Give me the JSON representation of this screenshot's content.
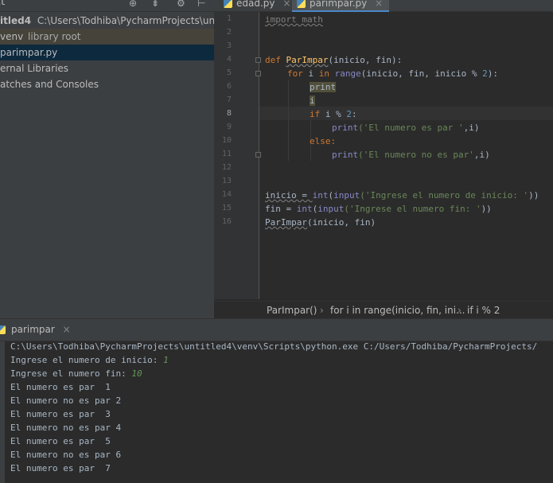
{
  "project": {
    "header_text": "ct",
    "rows": [
      {
        "name_bold": "itled4",
        "path": "C:\\Users\\Todhiba\\PycharmProjects\\untitled4"
      },
      {
        "name": "venv",
        "dim": "library root"
      },
      {
        "name": "parimpar.py",
        "selected": true
      },
      {
        "name": "ernal Libraries"
      },
      {
        "name": "atches and Consoles"
      }
    ]
  },
  "editor": {
    "tabs": [
      {
        "label": "edad.py",
        "active": false
      },
      {
        "label": "parimpar.py",
        "active": true
      }
    ],
    "current_line": 8,
    "line_numbers": [
      "1",
      "2",
      "3",
      "4",
      "5",
      "6",
      "7",
      "8",
      "9",
      "10",
      "11",
      "12",
      "13",
      "14",
      "15",
      "16"
    ],
    "code": {
      "l1": "import math",
      "l4_def": "def ",
      "l4_name": "ParImpar",
      "l4_rest": "(inicio, fin):",
      "l5_for": "for ",
      "l5_i": "i ",
      "l5_in": "in ",
      "l5_range": "range",
      "l5_rest": "(inicio, fin, inicio % ",
      "l5_num": "2",
      "l5_end": "):",
      "l6": "print",
      "l7": "i",
      "l8_if": "if ",
      "l8_rest": "i % ",
      "l8_num": "2",
      "l8_end": ":",
      "l9_print": "print",
      "l9_str": "('El numero es par '",
      "l9_end": ",i)",
      "l10": "else:",
      "l11_print": "print",
      "l11_str": "('El numero no es par'",
      "l11_end": ",i)",
      "l14_a": "inicio = ",
      "l14_int": "int",
      "l14_b": "(",
      "l14_input": "input",
      "l14_str": "('Ingrese el numero de inicio: '",
      "l14_end": "))",
      "l15_a": "fin = ",
      "l15_int": "int",
      "l15_b": "(",
      "l15_input": "input",
      "l15_str": "('Ingrese el numero fin: '",
      "l15_end": "))",
      "l16_name": "ParImpar",
      "l16_rest": "(inicio, fin)"
    },
    "breadcrumbs": [
      "ParImpar()",
      "for i in range(inicio, fin, ini...",
      "if i % 2"
    ]
  },
  "run": {
    "tab_label": "parimpar",
    "console": [
      {
        "text": "C:\\Users\\Todhiba\\PycharmProjects\\untitled4\\venv\\Scripts\\python.exe C:/Users/Todhiba/PycharmProjects/"
      },
      {
        "text": "Ingrese el numero de inicio: ",
        "input": "1"
      },
      {
        "text": "Ingrese el numero fin: ",
        "input": "10"
      },
      {
        "text": "El numero es par  1"
      },
      {
        "text": "El numero no es par 2"
      },
      {
        "text": "El numero es par  3"
      },
      {
        "text": "El numero no es par 4"
      },
      {
        "text": "El numero es par  5"
      },
      {
        "text": "El numero no es par 6"
      },
      {
        "text": "El numero es par  7"
      }
    ]
  }
}
